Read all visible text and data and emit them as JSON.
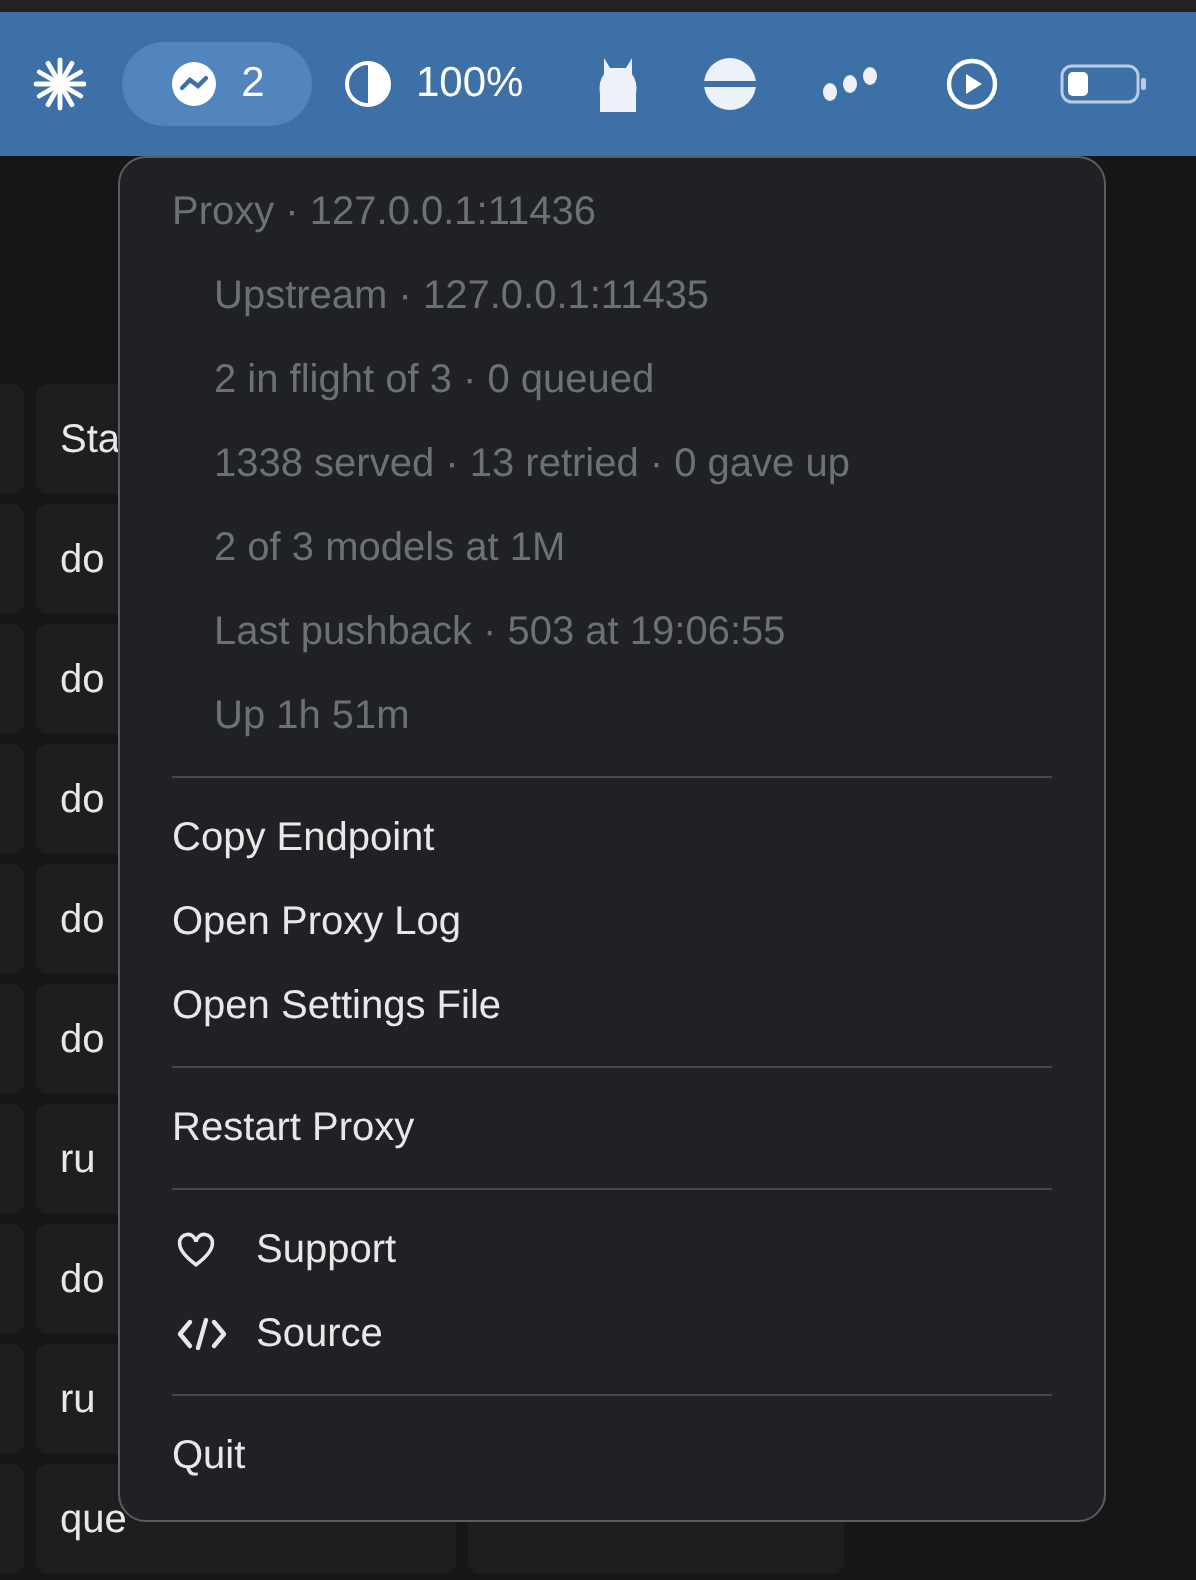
{
  "menu_bar": {
    "status_badge": {
      "count": "2",
      "selected": true
    },
    "display_level": "100%"
  },
  "table": {
    "header": "Sta",
    "rows": [
      "do",
      "do",
      "do",
      "do",
      "do",
      "ru",
      "do",
      "ru",
      "que"
    ]
  },
  "menu": {
    "header": "Proxy · 127.0.0.1:11436",
    "stats": [
      "Upstream · 127.0.0.1:11435",
      "2 in flight of 3 · 0 queued",
      "1338 served · 13 retried · 0 gave up",
      "2 of 3 models at 1M",
      "Last pushback · 503 at 19:06:55",
      "Up 1h 51m"
    ],
    "groups": [
      [
        {
          "label": "Copy Endpoint"
        },
        {
          "label": "Open Proxy Log"
        },
        {
          "label": "Open Settings File"
        }
      ],
      [
        {
          "label": "Restart Proxy"
        }
      ],
      [
        {
          "label": "Support",
          "kind": "heart"
        },
        {
          "label": "Source",
          "kind": "code"
        }
      ],
      [
        {
          "label": "Quit"
        }
      ]
    ]
  }
}
